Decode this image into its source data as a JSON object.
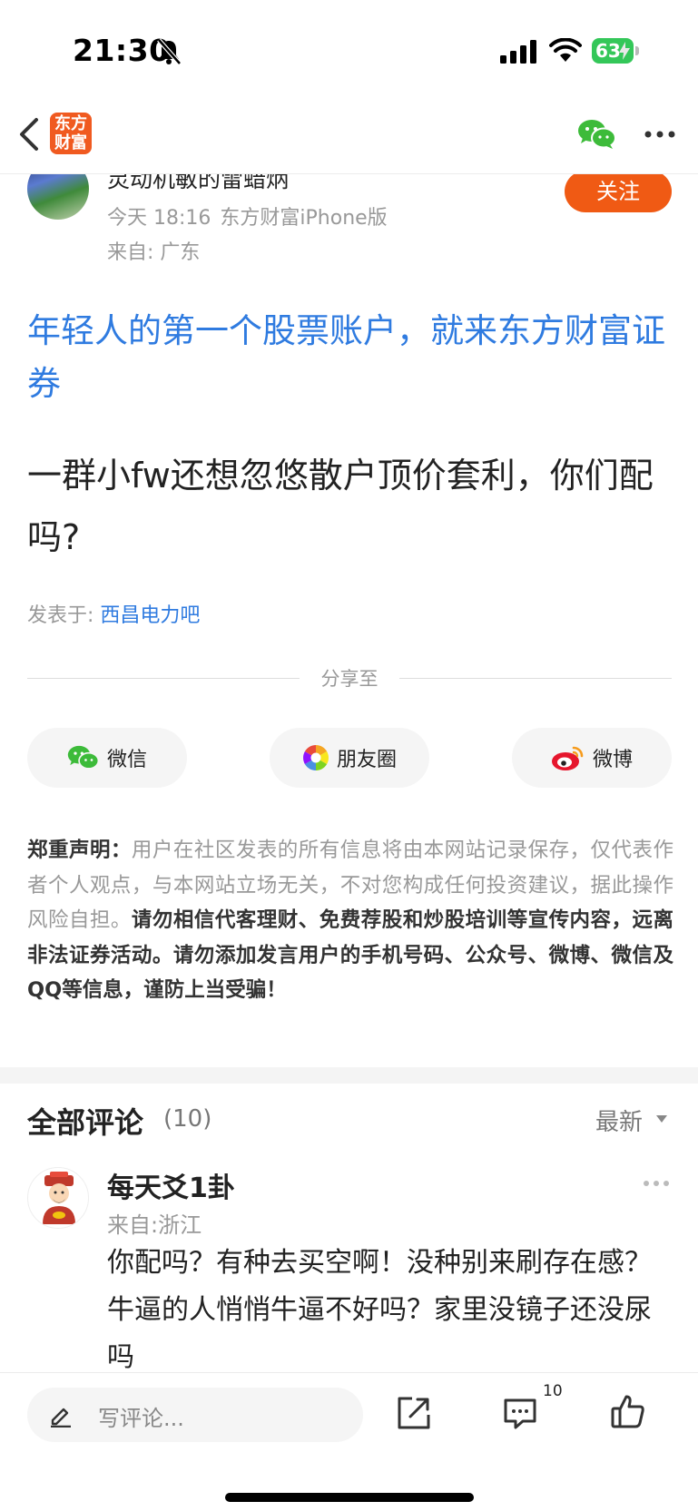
{
  "status_bar": {
    "time": "21:30",
    "battery": "63"
  },
  "nav": {
    "logo_text_line1": "东方",
    "logo_text_line2": "财富"
  },
  "author": {
    "name": "灵动机敏的雷蜡炳",
    "time": "今天 18:16",
    "device": "东方财富iPhone版",
    "location": "来自: 广东",
    "follow_label": "关注"
  },
  "post": {
    "ad_title": "年轻人的第一个股票账户，就来东方财富证券",
    "body": "一群小fw还想忽悠散户顶价套利，你们配吗?",
    "posted_in_label": "发表于: ",
    "posted_in_bar": "西昌电力吧"
  },
  "share": {
    "label": "分享至",
    "wechat": "微信",
    "moments": "朋友圈",
    "weibo": "微博"
  },
  "disclaimer": {
    "head": "郑重声明：",
    "normal": "用户在社区发表的所有信息将由本网站记录保存，仅代表作者个人观点，与本网站立场无关，不对您构成任何投资建议，据此操作风险自担。",
    "bold": "请勿相信代客理财、免费荐股和炒股培训等宣传内容，远离非法证券活动。请勿添加发言用户的手机号码、公众号、微博、微信及QQ等信息，谨防上当受骗！"
  },
  "comments": {
    "title": "全部评论",
    "count": "(10)",
    "sort": "最新",
    "items": [
      {
        "name": "每天爻1卦",
        "location": "来自:浙江",
        "text": "你配吗？有种去买空啊！没种别来刷存在感？牛逼的人悄悄牛逼不好吗？家里没镜子还没尿吗"
      }
    ]
  },
  "bottom_bar": {
    "comment_placeholder": "写评论...",
    "comment_badge": "10"
  },
  "colors": {
    "brand_orange": "#f05a14",
    "link_blue": "#2f7be0",
    "wechat_green": "#3dbb3a"
  },
  "icons": {
    "back": "chevron-left-icon",
    "wechat": "wechat-icon",
    "more": "more-dots-icon",
    "moments": "moments-aperture-icon",
    "weibo": "weibo-icon",
    "pen": "pen-icon",
    "share": "share-out-icon",
    "comment": "comment-bubble-icon",
    "like": "thumbs-up-icon"
  }
}
